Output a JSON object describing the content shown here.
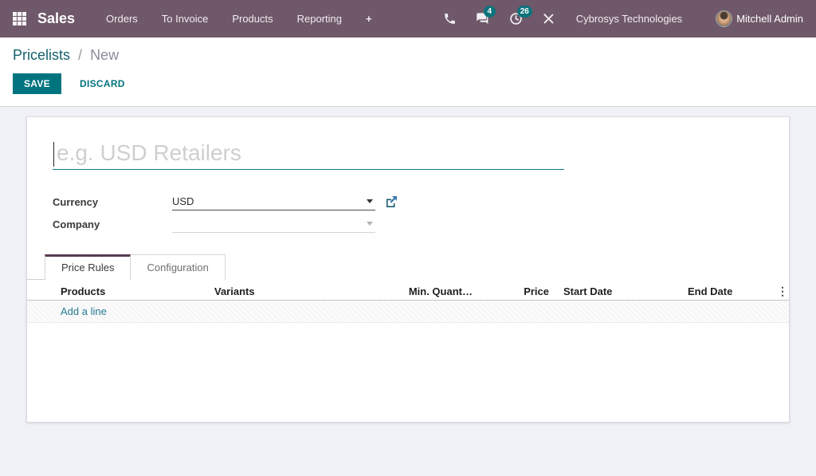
{
  "navbar": {
    "app_name": "Sales",
    "menu_items": [
      "Orders",
      "To Invoice",
      "Products",
      "Reporting"
    ],
    "plus_label": "+",
    "messages_badge": "4",
    "activities_badge": "26",
    "company_name": "Cybrosys Technologies",
    "user_name": "Mitchell Admin"
  },
  "breadcrumb": {
    "parent": "Pricelists",
    "separator": "/",
    "current": "New"
  },
  "actions": {
    "save": "SAVE",
    "discard": "DISCARD"
  },
  "form": {
    "name_placeholder": "e.g. USD Retailers",
    "name_value": "",
    "currency_label": "Currency",
    "currency_value": "USD",
    "company_label": "Company",
    "company_value": ""
  },
  "tabs": {
    "price_rules": "Price Rules",
    "configuration": "Configuration"
  },
  "price_rules_table": {
    "columns": [
      "Products",
      "Variants",
      "Min. Quant…",
      "Price",
      "Start Date",
      "End Date"
    ],
    "add_line": "Add a line",
    "kebab": "⋮"
  },
  "colors": {
    "navbar_bg": "#6e5869",
    "accent_teal": "#00747e",
    "badge_teal": "#0c737c",
    "active_tab_border": "#5a3a53",
    "link": "#267a8e",
    "page_bg": "#f1f2f7"
  }
}
